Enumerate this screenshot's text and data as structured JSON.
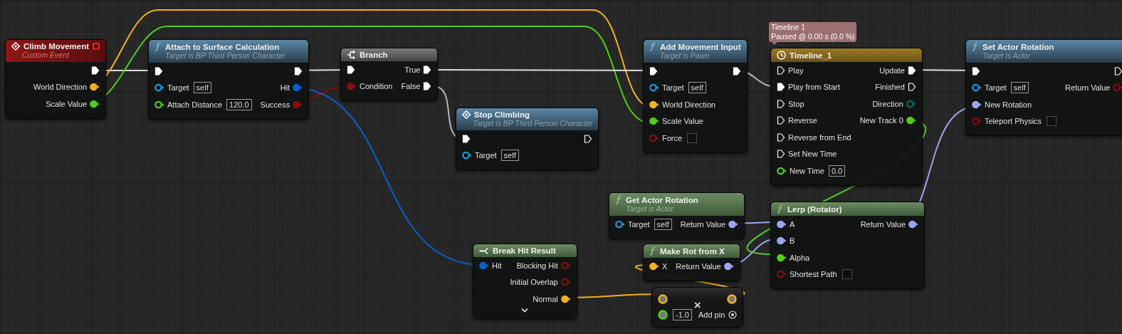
{
  "tooltip": {
    "title": "Timeline 1",
    "status": "Paused @ 0.00 s (0.0 %)"
  },
  "nodes": [
    {
      "kind": "event",
      "title": "Climb Movement",
      "subtitle": "Custom Event",
      "outputs": [
        {
          "kind": "exec",
          "connected": true
        },
        {
          "kind": "data",
          "label": "World Direction",
          "color": "#f2b01e",
          "connected": true
        },
        {
          "kind": "data",
          "label": "Scale Value",
          "color": "#4fcf18",
          "connected": true
        }
      ]
    },
    {
      "kind": "function",
      "title": "Attach to Surface Calculation",
      "subtitle": "Target is BP Third Person Character",
      "inputs": [
        {
          "kind": "exec",
          "connected": true
        },
        {
          "kind": "data",
          "label": "Target",
          "color": "#1c9ce0",
          "connected": false,
          "value": "self"
        },
        {
          "kind": "data",
          "label": "Attach Distance",
          "color": "#4fcf18",
          "connected": false,
          "value": "120.0"
        }
      ],
      "outputs": [
        {
          "kind": "exec",
          "connected": true
        },
        {
          "kind": "data",
          "label": "Hit",
          "color": "#0b5ed0",
          "connected": true
        },
        {
          "kind": "data",
          "label": "Success",
          "color": "#8c0d0d",
          "connected": true
        }
      ]
    },
    {
      "kind": "branch",
      "title": "Branch",
      "inputs": [
        {
          "kind": "exec",
          "connected": true
        },
        {
          "kind": "data",
          "label": "Condition",
          "color": "#8c0d0d",
          "connected": true
        }
      ],
      "outputs": [
        {
          "kind": "exec",
          "label": "True",
          "connected": true
        },
        {
          "kind": "exec",
          "label": "False",
          "connected": true
        }
      ]
    },
    {
      "kind": "call",
      "title": "Stop Climbing",
      "subtitle": "Target is BP Third Person Character",
      "inputs": [
        {
          "kind": "exec",
          "connected": true
        },
        {
          "kind": "data",
          "label": "Target",
          "color": "#1c9ce0",
          "connected": false,
          "value": "self"
        }
      ],
      "outputs": [
        {
          "kind": "exec",
          "connected": false
        }
      ]
    },
    {
      "kind": "function",
      "title": "Add Movement Input",
      "subtitle": "Target is Pawn",
      "inputs": [
        {
          "kind": "exec",
          "connected": true
        },
        {
          "kind": "data",
          "label": "Target",
          "color": "#1c9ce0",
          "connected": false,
          "value": "self"
        },
        {
          "kind": "data",
          "label": "World Direction",
          "color": "#f2b01e",
          "connected": true
        },
        {
          "kind": "data",
          "label": "Scale Value",
          "color": "#4fcf18",
          "connected": true
        },
        {
          "kind": "data",
          "label": "Force",
          "color": "#8c0d0d",
          "connected": false,
          "checked": false
        }
      ],
      "outputs": [
        {
          "kind": "exec",
          "connected": true
        }
      ]
    },
    {
      "kind": "timeline",
      "title": "Timeline_1",
      "inputs": [
        {
          "kind": "exec",
          "label": "Play",
          "connected": false
        },
        {
          "kind": "exec",
          "label": "Play from Start",
          "connected": true
        },
        {
          "kind": "exec",
          "label": "Stop",
          "connected": false
        },
        {
          "kind": "exec",
          "label": "Reverse",
          "connected": false
        },
        {
          "kind": "exec",
          "label": "Reverse from End",
          "connected": false
        },
        {
          "kind": "exec",
          "label": "Set New Time",
          "connected": false
        },
        {
          "kind": "data",
          "label": "New Time",
          "color": "#4fcf18",
          "connected": false,
          "value": "0.0"
        }
      ],
      "outputs": [
        {
          "kind": "exec",
          "label": "Update",
          "connected": true
        },
        {
          "kind": "exec",
          "label": "Finished",
          "connected": false
        },
        {
          "kind": "data",
          "label": "Direction",
          "color": "#0b6b6b",
          "connected": false
        },
        {
          "kind": "data",
          "label": "New Track 0",
          "color": "#4fcf18",
          "connected": true
        }
      ]
    },
    {
      "kind": "function",
      "title": "Set Actor Rotation",
      "subtitle": "Target is Actor",
      "inputs": [
        {
          "kind": "exec",
          "connected": true
        },
        {
          "kind": "data",
          "label": "Target",
          "color": "#1c9ce0",
          "connected": false,
          "value": "self"
        },
        {
          "kind": "data",
          "label": "New Rotation",
          "color": "#9ca6f0",
          "connected": true
        },
        {
          "kind": "data",
          "label": "Teleport Physics",
          "color": "#8c0d0d",
          "connected": false,
          "checked": false
        }
      ],
      "outputs": [
        {
          "kind": "exec",
          "connected": false
        },
        {
          "kind": "data",
          "label": "Return Value",
          "color": "#8c0d0d",
          "connected": false
        }
      ]
    },
    {
      "kind": "pure",
      "title": "Get Actor Rotation",
      "subtitle": "Target is Actor",
      "inputs": [
        {
          "kind": "data",
          "label": "Target",
          "color": "#1c9ce0",
          "connected": false,
          "value": "self"
        }
      ],
      "outputs": [
        {
          "kind": "data",
          "label": "Return Value",
          "color": "#9ca6f0",
          "connected": true
        }
      ]
    },
    {
      "kind": "pure",
      "title": "Lerp (Rotator)",
      "inputs": [
        {
          "kind": "data",
          "label": "A",
          "color": "#9ca6f0",
          "connected": true
        },
        {
          "kind": "data",
          "label": "B",
          "color": "#9ca6f0",
          "connected": true
        },
        {
          "kind": "data",
          "label": "Alpha",
          "color": "#4fcf18",
          "connected": true
        },
        {
          "kind": "data",
          "label": "Shortest Path",
          "color": "#8c0d0d",
          "connected": false,
          "checked": false
        }
      ],
      "outputs": [
        {
          "kind": "data",
          "label": "Return Value",
          "color": "#9ca6f0",
          "connected": true
        }
      ]
    },
    {
      "kind": "break",
      "title": "Break Hit Result",
      "expandable": true,
      "inputs": [
        {
          "kind": "data",
          "label": "Hit",
          "color": "#0b5ed0",
          "connected": true
        }
      ],
      "outputs": [
        {
          "kind": "data",
          "label": "Blocking Hit",
          "color": "#8c0d0d",
          "connected": false
        },
        {
          "kind": "data",
          "label": "Initial Overlap",
          "color": "#8c0d0d",
          "connected": false
        },
        {
          "kind": "data",
          "label": "Normal",
          "color": "#f2b01e",
          "connected": true
        }
      ]
    },
    {
      "kind": "pure",
      "title": "Make Rot from X",
      "inputs": [
        {
          "kind": "data",
          "label": "X",
          "color": "#f2b01e",
          "connected": true
        }
      ],
      "outputs": [
        {
          "kind": "data",
          "label": "Return Value",
          "color": "#9ca6f0",
          "connected": true
        }
      ]
    },
    {
      "kind": "compact",
      "operator": "×",
      "add_pin": "Add pin",
      "inputs": [
        {
          "kind": "wildcard",
          "color": "#f2b01e"
        },
        {
          "kind": "wildcard",
          "color": "#4fcf18",
          "value": "-1.0"
        }
      ],
      "outputs": [
        {
          "kind": "wildcard",
          "color": "#f2b01e"
        }
      ]
    }
  ]
}
